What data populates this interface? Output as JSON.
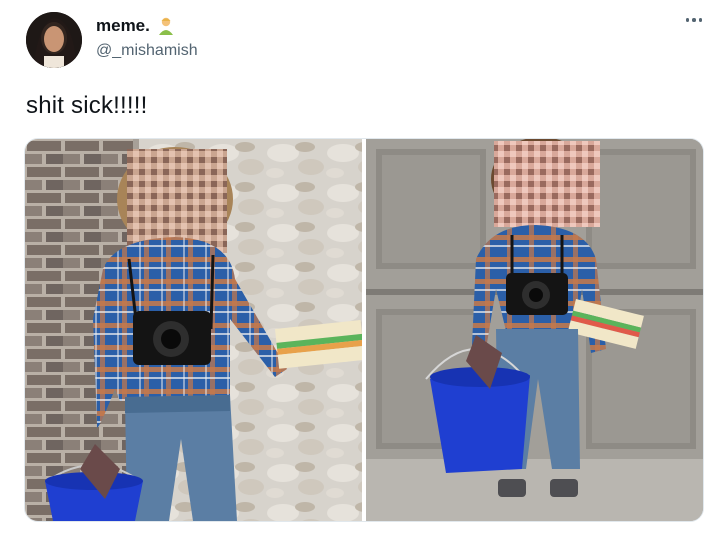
{
  "tweet": {
    "author_name": "meme.",
    "author_handle": "@_mishamish",
    "text": "shit sick!!!!!",
    "more_icon": "ellipsis-icon",
    "name_emoji": "person-emoji-icon"
  },
  "media": {
    "photos": [
      {
        "name": "photo-left"
      },
      {
        "name": "photo-right"
      }
    ]
  },
  "colors": {
    "text": "#0f1419",
    "secondary": "#536471",
    "bucket_blue": "#1f3fd1"
  }
}
